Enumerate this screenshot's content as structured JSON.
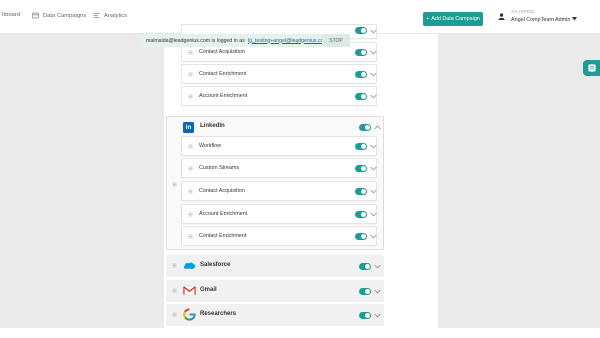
{
  "nav": {
    "items": [
      {
        "label": "hboard",
        "icon": "dashboard-icon"
      },
      {
        "label": "Data Campaigns",
        "icon": "campaign-icon"
      },
      {
        "label": "Analytics",
        "icon": "analytics-icon"
      }
    ],
    "add_label": "Add Data Campaign"
  },
  "user": {
    "title": "AA | EFDC",
    "name": "Angel CompTeam Admin"
  },
  "impersonation": {
    "user": "malmaida@leadgenius.com",
    "text": " is logged in as ",
    "as_user": "lg_testing+angel@leadgenius.com",
    "stop": "STOP"
  },
  "subitems_top": [
    {
      "label": "Custom Streams"
    },
    {
      "label": "Contact Acquisition"
    },
    {
      "label": "Contact Enrichment"
    },
    {
      "label": "Account Enrichment"
    }
  ],
  "linkedin": {
    "name": "LinkedIn",
    "logo": "in",
    "items": [
      {
        "label": "Workflow"
      },
      {
        "label": "Custom Streams"
      },
      {
        "label": "Contact Acquisition"
      },
      {
        "label": "Account Enrichment"
      },
      {
        "label": "Contact Enrichment"
      }
    ]
  },
  "groups": [
    {
      "name": "Salesforce",
      "icon": "salesforce-logo-icon"
    },
    {
      "name": "Gmail",
      "icon": "gmail-logo-icon"
    },
    {
      "name": "Researchers",
      "icon": "google-logo-icon"
    }
  ],
  "colors": {
    "accent": "#1d9c96",
    "linkedin": "#0a66c2",
    "salesforce": "#00a1e0"
  }
}
